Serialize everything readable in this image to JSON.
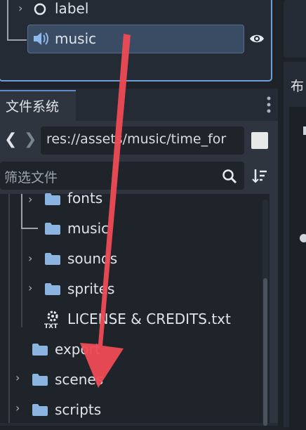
{
  "scene_tree": {
    "nodes": [
      {
        "label": "label",
        "icon": "circle-outline-icon"
      },
      {
        "label": "music",
        "icon": "speaker-icon",
        "selected": true,
        "visible_icon": "eye-icon"
      }
    ]
  },
  "right_dock": {
    "tab_label": "布"
  },
  "filesystem": {
    "tab_label": "文件系统",
    "path": "res://assets/music/time_for",
    "filter_placeholder": "筛选文件",
    "items": [
      {
        "label": "fonts",
        "type": "folder"
      },
      {
        "label": "music",
        "type": "folder"
      },
      {
        "label": "sounds",
        "type": "folder"
      },
      {
        "label": "sprites",
        "type": "folder"
      },
      {
        "label": "LICENSE & CREDITS.txt",
        "type": "txt-file"
      },
      {
        "label": "export",
        "type": "folder"
      },
      {
        "label": "scenes",
        "type": "folder"
      },
      {
        "label": "scripts",
        "type": "folder"
      }
    ]
  },
  "colors": {
    "accent": "#6f9fd6",
    "folder": "#8cb4e0",
    "annotation": "#ee4b55"
  }
}
